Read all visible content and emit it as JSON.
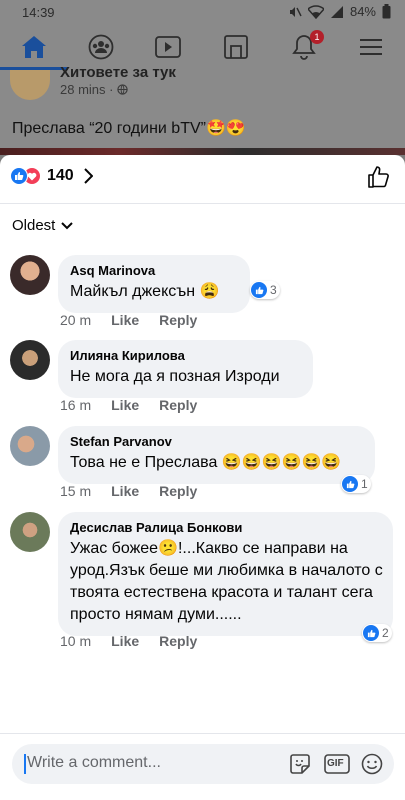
{
  "status_bar": {
    "time": "14:39",
    "battery": "84%"
  },
  "nav": {
    "notifications_badge": "1"
  },
  "post": {
    "page_name": "Хитовете за тук",
    "meta": "28 mins ·",
    "text": "Преслава “20 години bTV”🤩😍"
  },
  "reactions": {
    "count": "140"
  },
  "sort": {
    "label": "Oldest"
  },
  "comments": [
    {
      "author": "Asq Marinova",
      "text": "Майкъл джексън 😩",
      "time": "20 m",
      "like": "Like",
      "reply": "Reply",
      "reaction_count": "3"
    },
    {
      "author": "Илияна Кирилова",
      "text": "Не мога да я позная Изроди",
      "time": "16 m",
      "like": "Like",
      "reply": "Reply"
    },
    {
      "author": "Stefan Parvanov",
      "text": "Това не е Преслава 😆😆😆😆😆😆",
      "time": "15 m",
      "like": "Like",
      "reply": "Reply",
      "reaction_count": "1"
    },
    {
      "author": "Десислав Ралица Бонкови",
      "text": "Ужас божее😕!...Какво се направи на урод.Язък беше ми любимка в началото с твоята естествена красота и талант сега просто нямам думи......",
      "time": "10 m",
      "like": "Like",
      "reply": "Reply",
      "reaction_count": "2"
    }
  ],
  "composer": {
    "placeholder": "Write a comment...",
    "gif_label": "GIF"
  },
  "colors": {
    "like_blue": "#1877f2",
    "love_red": "#f33e58",
    "bubble_bg": "#f0f2f5",
    "secondary_text": "#65676b"
  }
}
